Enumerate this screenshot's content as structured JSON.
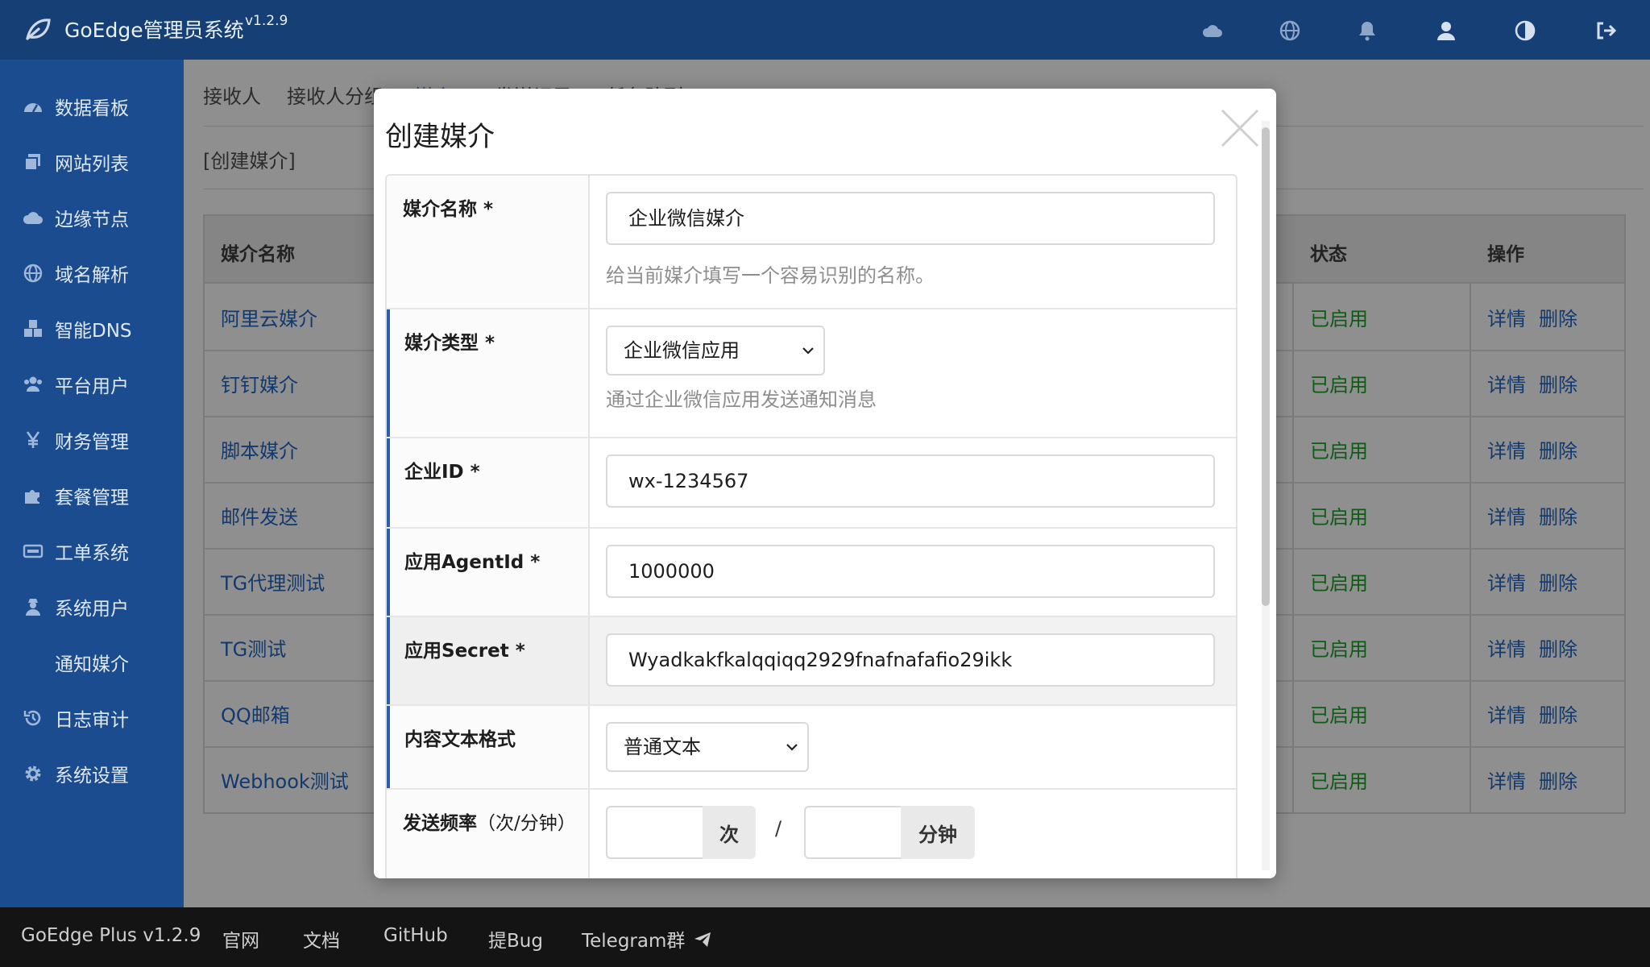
{
  "app": {
    "title": "GoEdge管理员系统",
    "version": "v1.2.9"
  },
  "top_icons": [
    "cloud-icon",
    "globe-icon",
    "bell-icon",
    "user-icon",
    "contrast-icon",
    "logout-icon"
  ],
  "sidebar": {
    "items": [
      {
        "label": "数据看板",
        "icon": "dashboard-icon"
      },
      {
        "label": "网站列表",
        "icon": "copy-icon"
      },
      {
        "label": "边缘节点",
        "icon": "cloud-icon"
      },
      {
        "label": "域名解析",
        "icon": "globe-icon"
      },
      {
        "label": "智能DNS",
        "icon": "cubes-icon"
      },
      {
        "label": "平台用户",
        "icon": "users-icon"
      },
      {
        "label": "财务管理",
        "icon": "yen-icon"
      },
      {
        "label": "套餐管理",
        "icon": "puzzle-icon"
      },
      {
        "label": "工单系统",
        "icon": "keyboard-icon"
      },
      {
        "label": "系统用户",
        "icon": "user-secret-icon"
      },
      {
        "label": "通知媒介",
        "icon": ""
      },
      {
        "label": "日志审计",
        "icon": "history-icon"
      },
      {
        "label": "系统设置",
        "icon": "gear-icon"
      }
    ]
  },
  "main": {
    "tabs": [
      "接收人",
      "接收人分组",
      "媒介",
      "发送记录",
      "任务队列"
    ],
    "breadcrumb": "[创建媒介]",
    "table": {
      "headers": {
        "name": "媒介名称",
        "status": "状态",
        "ops": "操作"
      },
      "rows": [
        {
          "name": "阿里云媒介",
          "status": "已启用"
        },
        {
          "name": "钉钉媒介",
          "status": "已启用"
        },
        {
          "name": "脚本媒介",
          "status": "已启用"
        },
        {
          "name": "邮件发送",
          "status": "已启用"
        },
        {
          "name": "TG代理测试",
          "status": "已启用"
        },
        {
          "name": "TG测试",
          "status": "已启用"
        },
        {
          "name": "QQ邮箱",
          "status": "已启用"
        },
        {
          "name": "Webhook测试",
          "status": "已启用"
        }
      ],
      "op_detail": "详情",
      "op_delete": "删除"
    }
  },
  "footer": {
    "items": [
      "GoEdge Plus v1.2.9",
      "官网",
      "文档",
      "GitHub",
      "提Bug",
      "Telegram群"
    ]
  },
  "modal": {
    "title": "创建媒介",
    "fields": {
      "name": {
        "label": "媒介名称 *",
        "value": "企业微信媒介",
        "hint": "给当前媒介填写一个容易识别的名称。"
      },
      "type": {
        "label": "媒介类型 *",
        "value": "企业微信应用",
        "hint": "通过企业微信应用发送通知消息"
      },
      "corp_id": {
        "label": "企业ID *",
        "value": "wx-1234567"
      },
      "agent_id": {
        "label": "应用AgentId *",
        "value": "1000000"
      },
      "secret": {
        "label": "应用Secret *",
        "value": "Wyadkakfkalqqiqq2929fnafnafafio29ikk"
      },
      "text_format": {
        "label": "内容文本格式",
        "value": "普通文本"
      },
      "rate": {
        "label": "发送频率",
        "unit_label": "（次/分钟）",
        "count_unit": "次",
        "separator": "/",
        "minute_unit": "分钟"
      }
    }
  }
}
